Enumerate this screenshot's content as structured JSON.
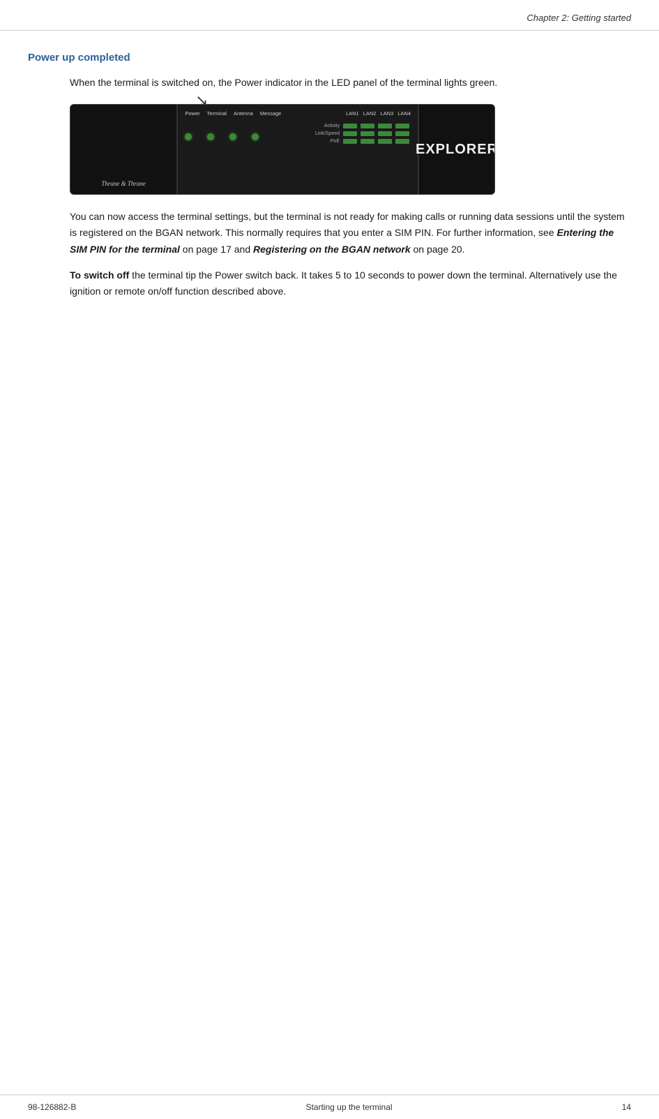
{
  "header": {
    "chapter_title": "Chapter 2: Getting started"
  },
  "section": {
    "heading": "Power up completed",
    "intro_paragraph": "When the terminal is switched on, the Power indicator in the LED panel of the terminal lights green.",
    "body_paragraph1": "You can now access the terminal settings, but the terminal is not ready for making calls or running data sessions until the system is registered on the BGAN network. This normally requires that you enter a SIM PIN. For further information, see ",
    "italic_bold_text1": "Entering the SIM PIN for the terminal",
    "mid_text1": " on page 17 and ",
    "italic_bold_text2": "Registering on the BGAN network",
    "mid_text2": " on page 20.",
    "body_paragraph2_bold": "To switch off",
    "body_paragraph2_rest": " the terminal tip the Power switch back. It takes 5 to 10 seconds to power down the terminal. Alternatively use the ignition or remote on/off function described above."
  },
  "device": {
    "brand_logo": "Thrane & Thrane",
    "explorer_text": "EXPLORER",
    "led_labels": {
      "power": "Power",
      "terminal": "Terminal",
      "antenna": "Antenna",
      "message": "Message",
      "lan1": "LAN1",
      "lan2": "LAN2",
      "lan3": "LAN3",
      "lan4": "LAN4",
      "activity": "Activity",
      "link_speed": "Link/Speed",
      "poe": "PoE"
    }
  },
  "footer": {
    "doc_number": "98-126882-B",
    "chapter_label": "Starting up the terminal",
    "page_number": "14"
  }
}
